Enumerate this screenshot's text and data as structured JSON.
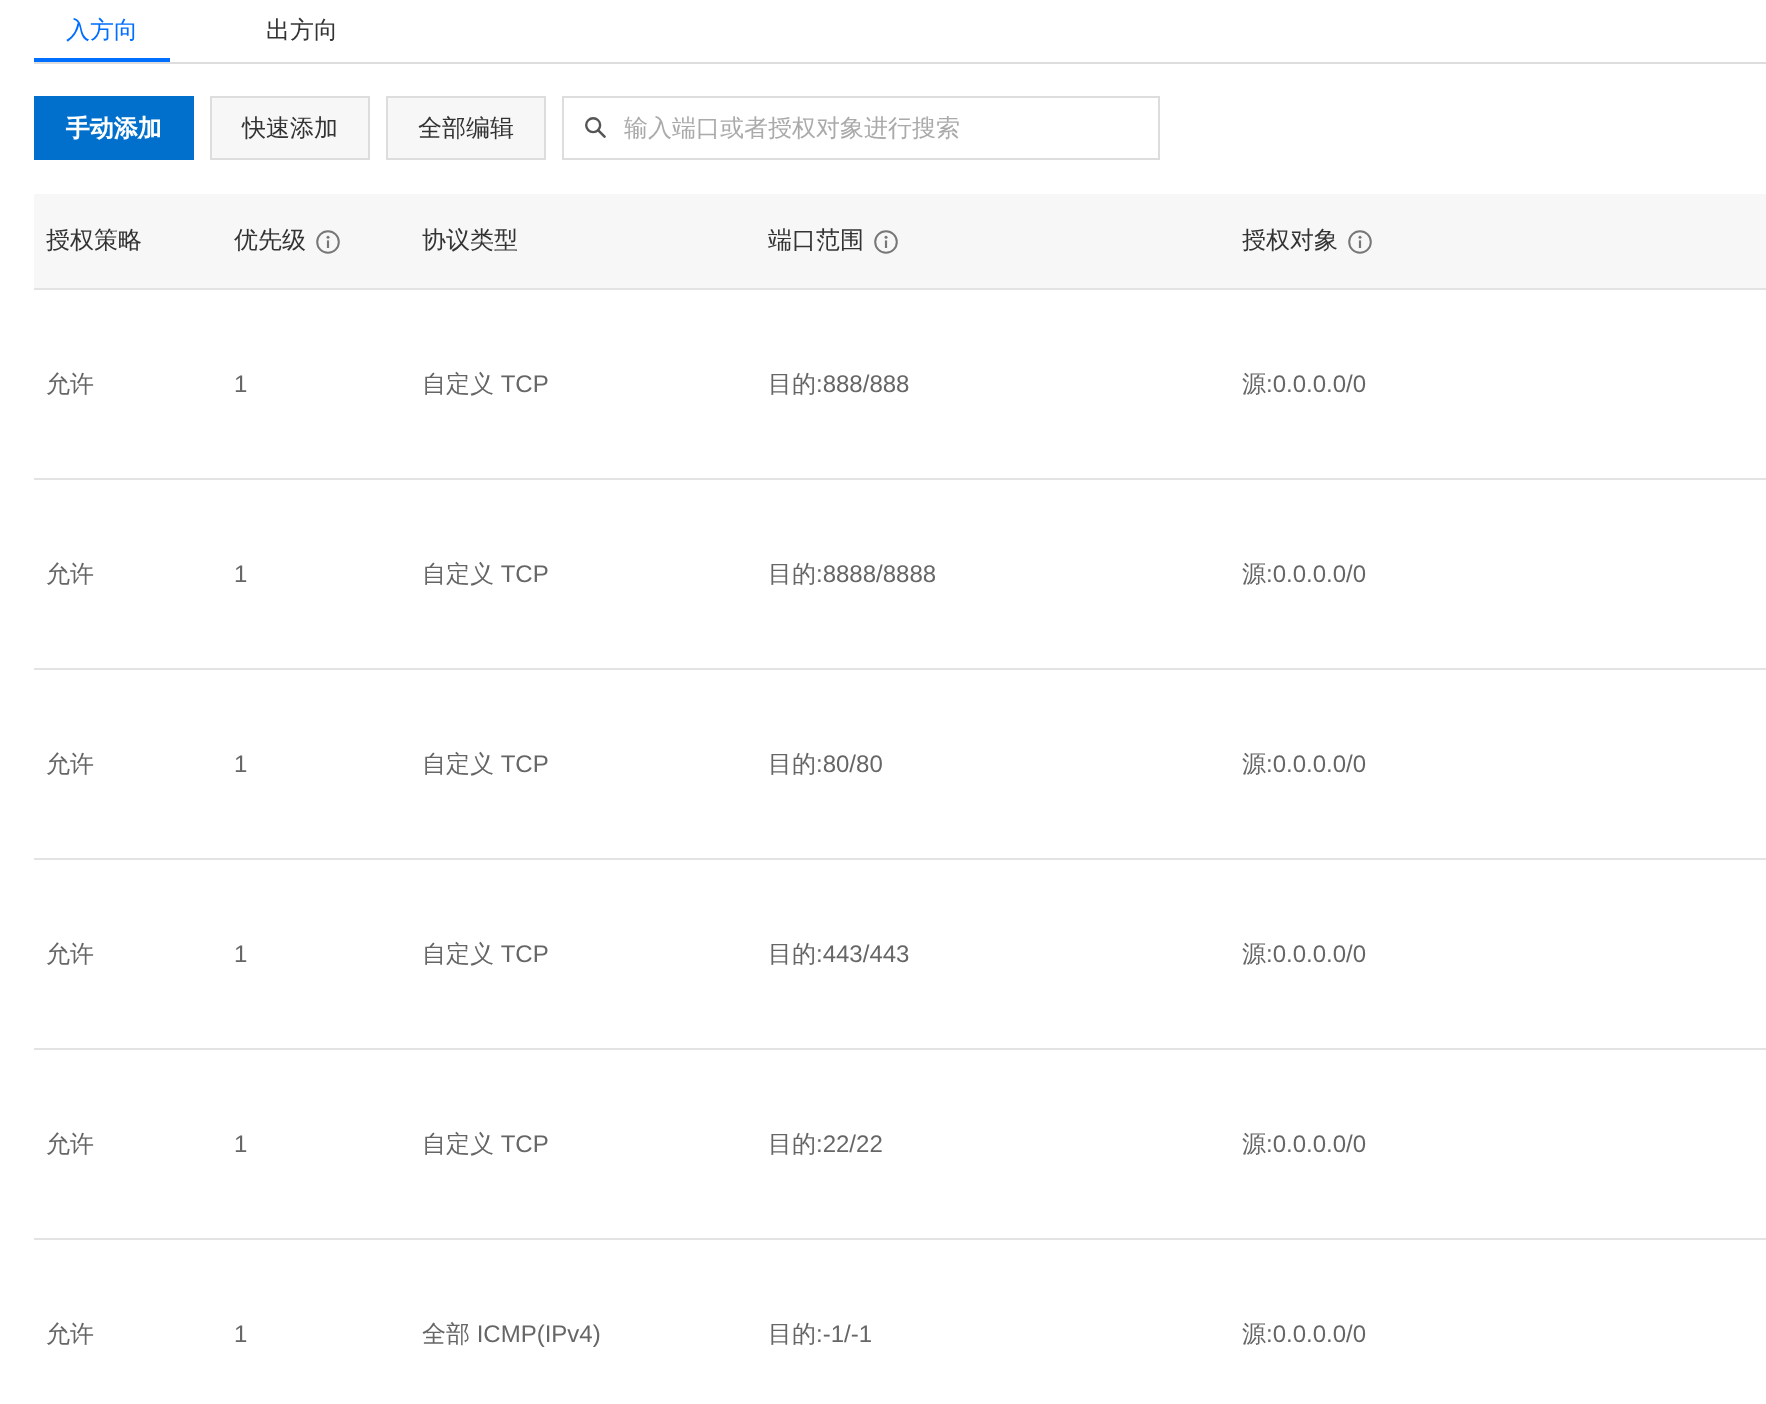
{
  "tabs": [
    {
      "label": "入方向",
      "selected": true
    },
    {
      "label": "出方向",
      "selected": false
    }
  ],
  "toolbar": {
    "buttons": [
      {
        "label": "手动添加",
        "kind": "primary"
      },
      {
        "label": "快速添加",
        "kind": "default"
      },
      {
        "label": "全部编辑",
        "kind": "default"
      }
    ],
    "search": {
      "placeholder": "输入端口或者授权对象进行搜索"
    }
  },
  "table": {
    "columns": [
      {
        "label": "授权策略",
        "info": false
      },
      {
        "label": "优先级",
        "info": true
      },
      {
        "label": "协议类型",
        "info": false
      },
      {
        "label": "端口范围",
        "info": true
      },
      {
        "label": "授权对象",
        "info": true
      }
    ],
    "rows": [
      [
        "允许",
        "1",
        "自定义 TCP",
        "目的:888/888",
        "源:0.0.0.0/0"
      ],
      [
        "允许",
        "1",
        "自定义 TCP",
        "目的:8888/8888",
        "源:0.0.0.0/0"
      ],
      [
        "允许",
        "1",
        "自定义 TCP",
        "目的:80/80",
        "源:0.0.0.0/0"
      ],
      [
        "允许",
        "1",
        "自定义 TCP",
        "目的:443/443",
        "源:0.0.0.0/0"
      ],
      [
        "允许",
        "1",
        "自定义 TCP",
        "目的:22/22",
        "源:0.0.0.0/0"
      ],
      [
        "允许",
        "1",
        "全部 ICMP(IPv4)",
        "目的:-1/-1",
        "源:0.0.0.0/0"
      ]
    ]
  }
}
